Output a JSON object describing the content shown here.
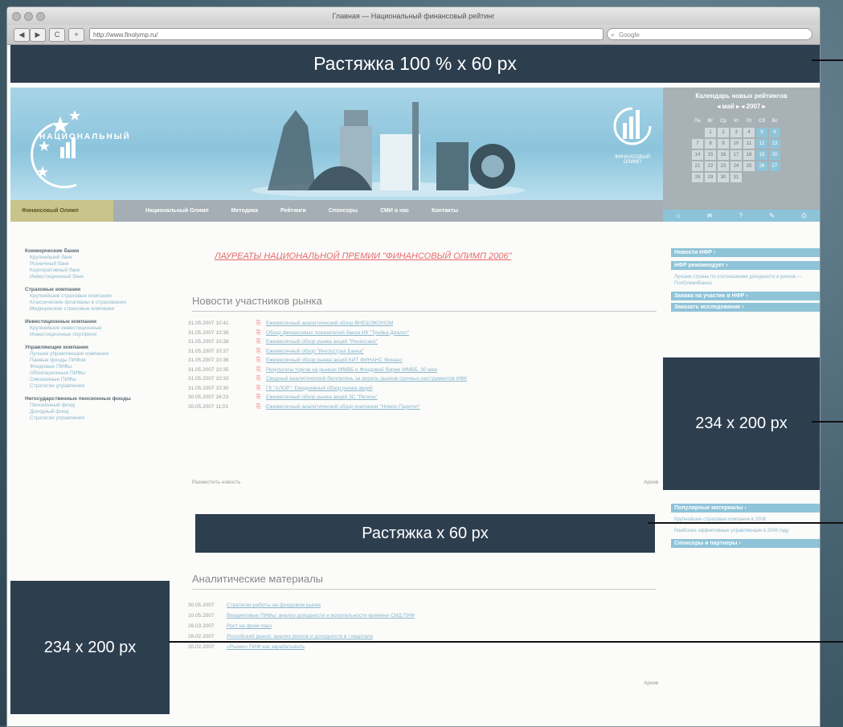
{
  "browser": {
    "title": "Главная — Национальный финансовый рейтинг",
    "nav": {
      "back": "◀",
      "forward": "▶",
      "refresh": "C",
      "add": "+"
    },
    "url": "http://www.finolymp.ru/",
    "search_placeholder": "Google"
  },
  "banners": {
    "top": "Растяжка 100 % x 60 px",
    "middle": "Растяжка x 60 px",
    "right_box": "234 x 200 px",
    "left_box": "234 x 200 px"
  },
  "header": {
    "logo_text": "НАЦИОНАЛЬНЫЙ",
    "logo_right_text": "ФИНАНСОВЫЙ ОЛИМП"
  },
  "calendar": {
    "title": "Календарь новых рейтингов",
    "month": "◂ май ▸ ◂ 2007 ▸",
    "days_header": [
      "Пн",
      "Вт",
      "Ср",
      "Чт",
      "Пт",
      "Сб",
      "Вс"
    ],
    "days": [
      "",
      "1",
      "2",
      "3",
      "4",
      "5",
      "6",
      "7",
      "8",
      "9",
      "10",
      "11",
      "12",
      "13",
      "14",
      "15",
      "16",
      "17",
      "18",
      "19",
      "20",
      "21",
      "22",
      "23",
      "24",
      "25",
      "26",
      "27",
      "28",
      "29",
      "30",
      "31",
      "",
      "",
      ""
    ],
    "icons": [
      "⌂",
      "✉",
      "?",
      "✎",
      "⎙"
    ]
  },
  "menu": {
    "items": [
      "Финансовый Олимп",
      "Национальный Олимп",
      "Методика",
      "Рейтинги",
      "Спонсоры",
      "СМИ о нас",
      "Контакты"
    ]
  },
  "left": {
    "groups": [
      {
        "title": "Коммерческие банки",
        "items": [
          "Крупнейший банк",
          "Розничный банк",
          "Корпоративный банк",
          "Инвестиционный банк"
        ]
      },
      {
        "title": "Страховые компании",
        "items": [
          "Крупнейшие страховые компании",
          "Классические флагманы в страховании",
          "Медицинские страховые компании"
        ]
      },
      {
        "title": "Инвестиционные компании",
        "items": [
          "Крупнейшие инвестиционные",
          "Инвестиционные портфели"
        ]
      },
      {
        "title": "Управляющие компании",
        "items": [
          "Лучшие управляющие компании",
          "Паевые фонды ПИФов",
          "Фондовые ПИФы",
          "Облигационные ПИФы",
          "Смешанные ПИФы",
          "Стратегии управления"
        ]
      },
      {
        "title": "Негосударственные пенсионные фонды",
        "items": [
          "Пенсионный фонд",
          "Доходный фонд",
          "Стратегия управления"
        ]
      }
    ]
  },
  "main": {
    "laureates": "ЛАУРЕАТЫ НАЦИОНАЛЬНОЙ ПРЕМИИ \"ФИНАНСОВЫЙ ОЛИМП 2006\"",
    "news_title": "Новости участников рынка",
    "news": [
      {
        "date": "31.05.2007 10:41",
        "text": "Ежемесячный аналитический обзор ВНЕШЭКОНОМ"
      },
      {
        "date": "31.05.2007 10:38",
        "text": "Обзор финансовых показателей банка ИК \"Тройка Диалог\""
      },
      {
        "date": "31.05.2007 10:38",
        "text": "Ежемесячный обзор рынка акций \"Ренессанс\""
      },
      {
        "date": "31.05.2007 10:37",
        "text": "Ежемесячный обзор \"Ингосстрах Банка\""
      },
      {
        "date": "31.05.2007 10:36",
        "text": "Ежемесячный обзор рынка акций КИТ ФИНАНС Финанс"
      },
      {
        "date": "31.05.2007 10:35",
        "text": "Результаты торгов на рынках ММВБ и Фондовой бирже ММВБ, 30 мая"
      },
      {
        "date": "31.05.2007 10:33",
        "text": "Сводный аналитический бюллетень за апрель рынков срочных инструментов ИФК"
      },
      {
        "date": "31.05.2007 10:30",
        "text": "ГК \"АЛОР\": Ежедневный обзор рынка акций"
      },
      {
        "date": "30.05.2007 16:23",
        "text": "Ежемесячный обзор рынка акций ЗС \"Регион\""
      },
      {
        "date": "30.05.2007 11:01",
        "text": "Ежемесячный аналитический обзор компании \"Номос-Паритет\""
      }
    ],
    "news_footer_left": "Разместить новость",
    "news_footer_right": "Архив",
    "analytics_title": "Аналитические материалы",
    "analytics": [
      {
        "date": "30.05.2007",
        "text": "Стратегии работы на фондовом рынке"
      },
      {
        "date": "10.05.2007",
        "text": "Вендинговые ПИФы: анализ доходности и волатильности времени СИД ПИФ"
      },
      {
        "date": "26.03.2007",
        "text": "Рост на фоне пауз"
      },
      {
        "date": "28.02.2007",
        "text": "Российский рынок: анализ рисков и доходности в I квартале"
      },
      {
        "date": "20.02.2007",
        "text": "«Рынки» ПИФ как зарабатывать"
      }
    ],
    "analytics_footer_right": "Архив"
  },
  "right": {
    "buttons_top": [
      "Новости НФР ›",
      "НФР рекомендует ›"
    ],
    "recommend_text": "Лучшие страны по соотношению доходности и рисков — ПолОлимпБанка",
    "buttons_mid": [
      "Заявка на участие в НФР ›",
      "Заказать исследование ›"
    ],
    "popular_button": "Популярные материалы ›",
    "popular_items": [
      "Крупнейшие страховые компании в 2006",
      "Наиболее эффективные управляющие в 2006 году"
    ],
    "partners_button": "Спонсоры и партнеры ›"
  }
}
